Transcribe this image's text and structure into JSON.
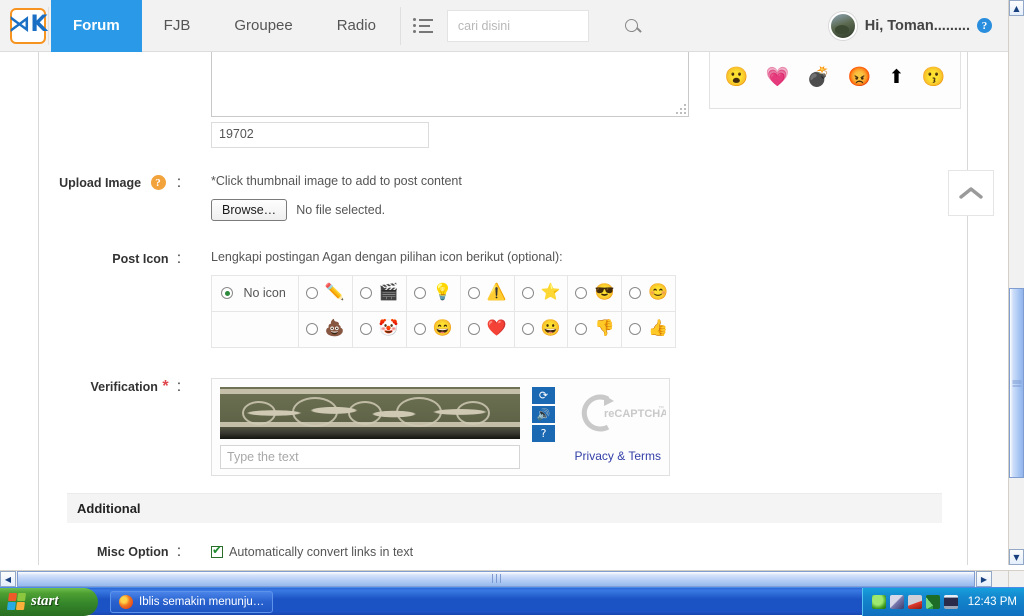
{
  "nav": {
    "logo": "kaskus-logo",
    "items": [
      {
        "label": "Forum",
        "active": true
      },
      {
        "label": "FJB",
        "active": false
      },
      {
        "label": "Groupee",
        "active": false
      },
      {
        "label": "Radio",
        "active": false
      }
    ],
    "category_icon": "category-list-icon",
    "search": {
      "value": "",
      "placeholder": "cari disini",
      "icon": "search-icon"
    },
    "user": {
      "greeting": "Hi, Toman.........",
      "avatar": "user-avatar",
      "help_icon": "help-question-icon"
    }
  },
  "editor": {
    "textarea_value": "",
    "char_count": "19702",
    "resize_handle": "resize-grip"
  },
  "emoticons": {
    "items": [
      {
        "name": "emoticon-shocked",
        "glyph": "😮"
      },
      {
        "name": "emoticon-heart",
        "glyph": "💗"
      },
      {
        "name": "emoticon-bomb",
        "glyph": "💣"
      },
      {
        "name": "emoticon-angry",
        "glyph": "😡"
      },
      {
        "name": "emoticon-up-arrow",
        "glyph": "⬆"
      },
      {
        "name": "emoticon-kiss",
        "glyph": "😗"
      }
    ]
  },
  "upload": {
    "label": "Upload Image",
    "colon": ":",
    "help_icon": "help-question-icon",
    "hint": "*Click thumbnail image to add to post content",
    "browse_button": "Browse…",
    "file_status": "No file selected."
  },
  "post_icon": {
    "label": "Post Icon",
    "colon": ":",
    "hint": "Lengkapi postingan Agan dengan pilihan icon berikut (optional):",
    "no_icon_label": "No icon",
    "no_icon_selected": true,
    "row1": [
      {
        "name": "icon-pencil",
        "glyph": "✏️"
      },
      {
        "name": "icon-clapperboard",
        "glyph": "🎬"
      },
      {
        "name": "icon-lightbulb",
        "glyph": "💡"
      },
      {
        "name": "icon-warning",
        "glyph": "⚠️"
      },
      {
        "name": "icon-star",
        "glyph": "⭐"
      },
      {
        "name": "icon-cool-sunglasses",
        "glyph": "😎"
      },
      {
        "name": "icon-smile-eyes",
        "glyph": "😊"
      }
    ],
    "row2": [
      {
        "name": "icon-poop",
        "glyph": "💩"
      },
      {
        "name": "icon-clown",
        "glyph": "🤡"
      },
      {
        "name": "icon-laugh",
        "glyph": "😄"
      },
      {
        "name": "icon-red-heart",
        "glyph": "❤️"
      },
      {
        "name": "icon-blue-smiley",
        "glyph": "😀"
      },
      {
        "name": "icon-thumbs-down",
        "glyph": "👎"
      },
      {
        "name": "icon-thumbs-up",
        "glyph": "👍"
      }
    ]
  },
  "verification": {
    "label": "Verification",
    "required_mark": "*",
    "colon": ":",
    "captcha_image": "captcha-challenge-image",
    "input_placeholder": "Type the text",
    "input_value": "",
    "refresh_icon": "refresh-captcha-icon",
    "audio_icon": "audio-captcha-icon",
    "help_icon": "captcha-help-icon",
    "brand": "reCAPTCHA",
    "brand_mark": "™",
    "privacy_terms": "Privacy & Terms"
  },
  "additional": {
    "section_title": "Additional",
    "misc_label": "Misc Option",
    "colon": ":",
    "checkbox_checked": true,
    "checkbox_label": "Automatically convert links in text"
  },
  "back_to_top": {
    "name": "back-to-top-button",
    "icon": "chevron-up-icon"
  },
  "taskbar": {
    "start_label": "start",
    "window_title": "Iblis semakin menunju…",
    "clock": "12:43 PM",
    "tray_icons": [
      "shield-icon",
      "network-icon",
      "removable-device-icon",
      "triangle-icon",
      "monitor-icon"
    ]
  },
  "colors": {
    "accent_blue": "#2a9ae8",
    "logo_orange": "#f79320",
    "link_blue": "#3440a8",
    "required_red": "#e0474c",
    "taskbar_blue": "#1b53c4",
    "start_green": "#35862a"
  }
}
